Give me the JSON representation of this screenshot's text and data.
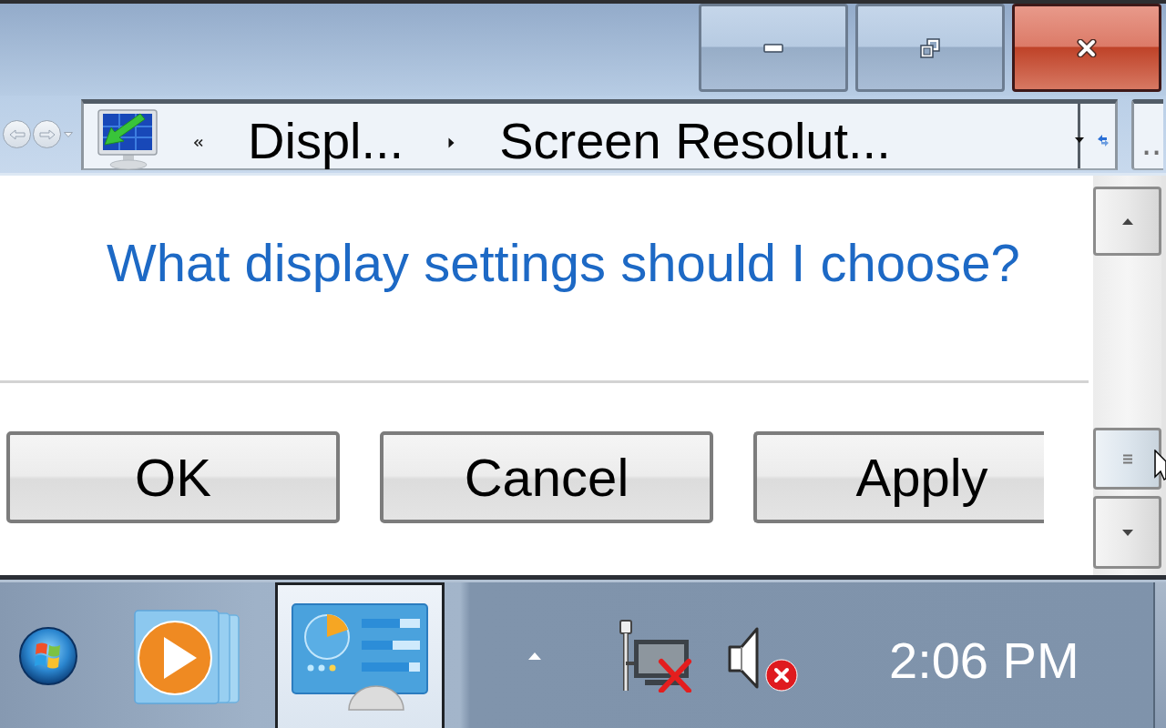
{
  "address_bar": {
    "breadcrumbs": [
      {
        "label": "Displ..."
      },
      {
        "label": "Screen Resolut..."
      }
    ],
    "search": {
      "placeholder": ".."
    }
  },
  "content": {
    "help_link": "What display settings should I choose?",
    "buttons": [
      {
        "label": "OK"
      },
      {
        "label": "Cancel"
      },
      {
        "label": "Apply"
      }
    ]
  },
  "taskbar": {
    "apps": [
      {
        "kind": "media-player",
        "selected": false
      },
      {
        "kind": "control-panel",
        "selected": true
      }
    ],
    "tray": [
      {
        "kind": "network",
        "disconnected": true
      },
      {
        "kind": "volume",
        "muted": true
      }
    ],
    "clock": "2:06 PM"
  }
}
